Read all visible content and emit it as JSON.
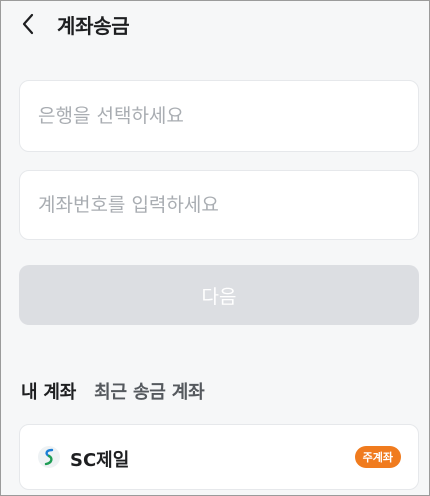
{
  "header": {
    "back_icon": "chevron-left-icon",
    "title": "계좌송금"
  },
  "form": {
    "bank_placeholder": "은행을 선택하세요",
    "account_placeholder": "계좌번호를 입력하세요",
    "next_label": "다음"
  },
  "tabs": [
    {
      "label": "내 계좌",
      "active": true
    },
    {
      "label": "최근 송금 계좌",
      "active": false
    }
  ],
  "accounts": [
    {
      "bank_name": "SC제일",
      "logo_icon": "sc-bank-logo-icon",
      "badge": "주계좌"
    }
  ],
  "colors": {
    "accent_badge": "#f07b1e",
    "logo_green": "#1f9d55",
    "logo_blue": "#1c7fd6",
    "disabled_button": "#dcdee2"
  }
}
